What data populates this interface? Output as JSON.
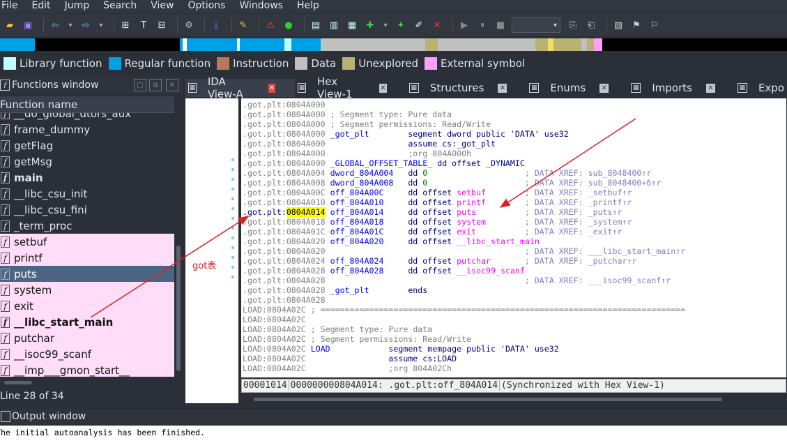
{
  "menu": [
    "File",
    "Edit",
    "Jump",
    "Search",
    "View",
    "Options",
    "Windows",
    "Help"
  ],
  "legend": [
    {
      "label": "Library function",
      "color": "#c0ffff"
    },
    {
      "label": "Regular function",
      "color": "#00a0e8"
    },
    {
      "label": "Instruction",
      "color": "#b5795b"
    },
    {
      "label": "Data",
      "color": "#c0c0c0"
    },
    {
      "label": "Unexplored",
      "color": "#b8b373"
    },
    {
      "label": "External symbol",
      "color": "#ffa0f8"
    }
  ],
  "functions_window": {
    "title": "Functions window",
    "column_header": "Function name",
    "status": "Line 28 of 34",
    "rows": [
      {
        "name": "__do_global_dtors_aux",
        "kind": "normal"
      },
      {
        "name": "frame_dummy",
        "kind": "normal"
      },
      {
        "name": "getFlag",
        "kind": "normal"
      },
      {
        "name": "getMsg",
        "kind": "normal"
      },
      {
        "name": "main",
        "kind": "bold"
      },
      {
        "name": "__libc_csu_init",
        "kind": "normal"
      },
      {
        "name": "__libc_csu_fini",
        "kind": "normal"
      },
      {
        "name": "_term_proc",
        "kind": "normal"
      },
      {
        "name": "setbuf",
        "kind": "ext"
      },
      {
        "name": "printf",
        "kind": "ext"
      },
      {
        "name": "puts",
        "kind": "sel"
      },
      {
        "name": "system",
        "kind": "ext"
      },
      {
        "name": "exit",
        "kind": "ext"
      },
      {
        "name": "__libc_start_main",
        "kind": "ext-bold"
      },
      {
        "name": "putchar",
        "kind": "ext"
      },
      {
        "name": "__isoc99_scanf",
        "kind": "ext"
      },
      {
        "name": "__imp___gmon_start__",
        "kind": "ext"
      }
    ]
  },
  "tabs": [
    {
      "label": "IDA View-A",
      "icon": "ida-view-icon",
      "active": true
    },
    {
      "label": "Hex View-1",
      "icon": "hex-view-icon",
      "active": false
    },
    {
      "label": "Structures",
      "icon": "structures-icon",
      "active": false
    },
    {
      "label": "Enums",
      "icon": "enums-icon",
      "active": false
    },
    {
      "label": "Imports",
      "icon": "imports-icon",
      "active": false
    },
    {
      "label": "Expo",
      "icon": "exports-icon",
      "active": false
    }
  ],
  "disasm_lines": [
    [
      {
        "t": ".got.plt:0804A000",
        "c": "addr"
      }
    ],
    [
      {
        "t": ".got.plt:0804A000 ",
        "c": "addr"
      },
      {
        "t": "; Segment type: Pure data",
        "c": "cm"
      }
    ],
    [
      {
        "t": ".got.plt:0804A000 ",
        "c": "addr"
      },
      {
        "t": "; Segment permissions: Read/Write",
        "c": "cm"
      }
    ],
    [
      {
        "t": ".got.plt:0804A000 ",
        "c": "addr"
      },
      {
        "t": "_got_plt        ",
        "c": "lbl"
      },
      {
        "t": "segment dword public 'DATA' use32",
        "c": "kw"
      }
    ],
    [
      {
        "t": ".got.plt:0804A000                 ",
        "c": "addr"
      },
      {
        "t": "assume cs:_got_plt",
        "c": "kw"
      }
    ],
    [
      {
        "t": ".got.plt:0804A000                 ",
        "c": "addr"
      },
      {
        "t": ";org 804A000h",
        "c": "cm"
      }
    ],
    [
      {
        "t": ".got.plt:0804A000 ",
        "c": "addr"
      },
      {
        "t": "_GLOBAL_OFFSET_TABLE_",
        "c": "lbl"
      },
      {
        "t": " dd offset _DYNAMIC",
        "c": "kw"
      }
    ],
    [
      {
        "t": ".got.plt:0804A004 ",
        "c": "addr"
      },
      {
        "t": "dword_804A004   ",
        "c": "lbl"
      },
      {
        "t": "dd ",
        "c": "kw"
      },
      {
        "t": "0",
        "c": "num"
      },
      {
        "t": "                    ; DATA XREF: sub_8048400↑r",
        "c": "xr"
      }
    ],
    [
      {
        "t": ".got.plt:0804A008 ",
        "c": "addr"
      },
      {
        "t": "dword_804A008   ",
        "c": "lbl"
      },
      {
        "t": "dd ",
        "c": "kw"
      },
      {
        "t": "0",
        "c": "num"
      },
      {
        "t": "                    ; DATA XREF: sub_8048400+6↑r",
        "c": "xr"
      }
    ],
    [
      {
        "t": ".got.plt:0804A00C ",
        "c": "addr"
      },
      {
        "t": "off_804A00C     ",
        "c": "lbl"
      },
      {
        "t": "dd offset ",
        "c": "kw"
      },
      {
        "t": "setbuf",
        "c": "ex"
      },
      {
        "t": "        ; DATA XREF: _setbuf↑r",
        "c": "xr"
      }
    ],
    [
      {
        "t": ".got.plt:0804A010 ",
        "c": "addr"
      },
      {
        "t": "off_804A010     ",
        "c": "lbl"
      },
      {
        "t": "dd offset ",
        "c": "kw"
      },
      {
        "t": "printf",
        "c": "ex"
      },
      {
        "t": "        ; DATA XREF: _printf↑r",
        "c": "xr"
      }
    ],
    [
      {
        "t": ".got.plt:",
        "c": "addr-sel"
      },
      {
        "t": "0804A014",
        "c": "hl"
      },
      {
        "t": " ",
        "c": "addr"
      },
      {
        "t": "off_804A014     ",
        "c": "lbl"
      },
      {
        "t": "dd offset ",
        "c": "kw"
      },
      {
        "t": "puts",
        "c": "ex"
      },
      {
        "t": "          ; DATA XREF: _puts↑r",
        "c": "xr"
      }
    ],
    [
      {
        "t": ".got.plt:0804A018 ",
        "c": "addr"
      },
      {
        "t": "off_804A018     ",
        "c": "lbl"
      },
      {
        "t": "dd offset ",
        "c": "kw"
      },
      {
        "t": "system",
        "c": "ex"
      },
      {
        "t": "        ; DATA XREF: _system↑r",
        "c": "xr"
      }
    ],
    [
      {
        "t": ".got.plt:0804A01C ",
        "c": "addr"
      },
      {
        "t": "off_804A01C     ",
        "c": "lbl"
      },
      {
        "t": "dd offset ",
        "c": "kw"
      },
      {
        "t": "exit",
        "c": "ex"
      },
      {
        "t": "          ; DATA XREF: _exit↑r",
        "c": "xr"
      }
    ],
    [
      {
        "t": ".got.plt:0804A020 ",
        "c": "addr"
      },
      {
        "t": "off_804A020     ",
        "c": "lbl"
      },
      {
        "t": "dd offset ",
        "c": "kw"
      },
      {
        "t": "__libc_start_main",
        "c": "ex"
      }
    ],
    [
      {
        "t": ".got.plt:0804A020                                         ",
        "c": "addr"
      },
      {
        "t": "; DATA XREF: ___libc_start_main↑r",
        "c": "xr"
      }
    ],
    [
      {
        "t": ".got.plt:0804A024 ",
        "c": "addr"
      },
      {
        "t": "off_804A024     ",
        "c": "lbl"
      },
      {
        "t": "dd offset ",
        "c": "kw"
      },
      {
        "t": "putchar",
        "c": "ex"
      },
      {
        "t": "       ; DATA XREF: _putchar↑r",
        "c": "xr"
      }
    ],
    [
      {
        "t": ".got.plt:0804A028 ",
        "c": "addr"
      },
      {
        "t": "off_804A028     ",
        "c": "lbl"
      },
      {
        "t": "dd offset ",
        "c": "kw"
      },
      {
        "t": "__isoc99_scanf",
        "c": "ex"
      }
    ],
    [
      {
        "t": ".got.plt:0804A028                                         ",
        "c": "addr"
      },
      {
        "t": "; DATA XREF: ___isoc99_scanf↑r",
        "c": "xr"
      }
    ],
    [
      {
        "t": ".got.plt:0804A028 ",
        "c": "addr"
      },
      {
        "t": "_got_plt        ",
        "c": "lbl"
      },
      {
        "t": "ends",
        "c": "kw"
      }
    ],
    [
      {
        "t": ".got.plt:0804A028",
        "c": "addr"
      }
    ],
    [
      {
        "t": "LOAD:0804A02C ",
        "c": "addr"
      },
      {
        "t": "; ===========================================================================",
        "c": "cm"
      }
    ],
    [
      {
        "t": "LOAD:0804A02C",
        "c": "addr"
      }
    ],
    [
      {
        "t": "LOAD:0804A02C ",
        "c": "addr"
      },
      {
        "t": "; Segment type: Pure data",
        "c": "cm"
      }
    ],
    [
      {
        "t": "LOAD:0804A02C ",
        "c": "addr"
      },
      {
        "t": "; Segment permissions: Read/Write",
        "c": "cm"
      }
    ],
    [
      {
        "t": "LOAD:0804A02C ",
        "c": "addr"
      },
      {
        "t": "LOAD            ",
        "c": "lbl"
      },
      {
        "t": "segment mempage public 'DATA' use32",
        "c": "kw"
      }
    ],
    [
      {
        "t": "LOAD:0804A02C                 ",
        "c": "addr"
      },
      {
        "t": "assume cs:LOAD",
        "c": "kw"
      }
    ],
    [
      {
        "t": "LOAD:0804A02C                 ",
        "c": "addr"
      },
      {
        "t": ";org 804A02Ch",
        "c": "cm"
      }
    ]
  ],
  "status_bar": [
    "00001014",
    "000000000804A014: .got.plt:off_804A014",
    "(Synchronized with Hex View-1)"
  ],
  "annotation": "got表",
  "output_window": {
    "title": "Output window",
    "text": "The initial autoanalysis has been finished."
  }
}
